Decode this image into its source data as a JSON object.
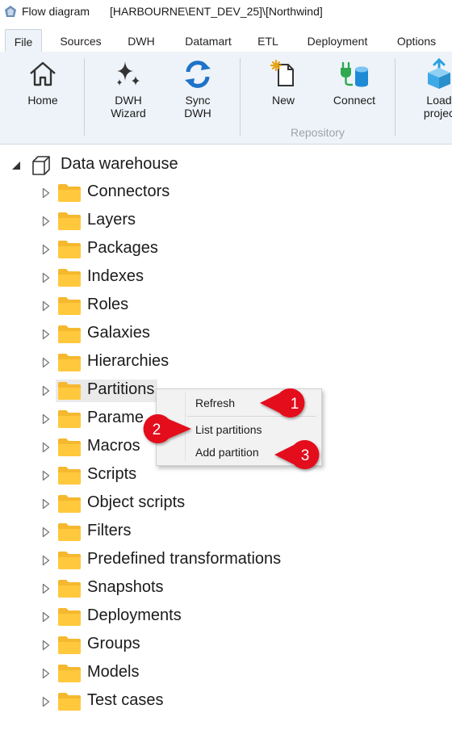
{
  "window": {
    "title": "Flow diagram",
    "path": "[HARBOURNE\\ENT_DEV_25]\\[Northwind]"
  },
  "tabs": [
    {
      "label": "File",
      "active": true
    },
    {
      "label": "Sources",
      "active": false
    },
    {
      "label": "DWH",
      "active": false
    },
    {
      "label": "Datamart",
      "active": false
    },
    {
      "label": "ETL",
      "active": false
    },
    {
      "label": "Deployment",
      "active": false
    },
    {
      "label": "Options",
      "active": false
    }
  ],
  "ribbon": {
    "home": {
      "label": "Home",
      "icon": "home-icon"
    },
    "dwh_wizard": {
      "label": "DWH\nWizard",
      "icon": "sparkle-icon"
    },
    "sync_dwh": {
      "label": "Sync\nDWH",
      "icon": "sync-icon"
    },
    "new": {
      "label": "New",
      "icon": "new-document-icon"
    },
    "connect": {
      "label": "Connect",
      "icon": "plug-database-icon"
    },
    "load_project": {
      "label": "Load\nprojec",
      "icon": "open-box-icon"
    },
    "group_repository": "Repository"
  },
  "tree": {
    "root": {
      "label": "Data warehouse",
      "icon": "cube-icon",
      "expanded": true
    },
    "items": [
      {
        "label": "Connectors"
      },
      {
        "label": "Layers"
      },
      {
        "label": "Packages"
      },
      {
        "label": "Indexes"
      },
      {
        "label": "Roles"
      },
      {
        "label": "Galaxies"
      },
      {
        "label": "Hierarchies"
      },
      {
        "label": "Partitions"
      },
      {
        "label": "Parame"
      },
      {
        "label": "Macros"
      },
      {
        "label": "Scripts"
      },
      {
        "label": "Object scripts"
      },
      {
        "label": "Filters"
      },
      {
        "label": "Predefined transformations"
      },
      {
        "label": "Snapshots"
      },
      {
        "label": "Deployments"
      },
      {
        "label": "Groups"
      },
      {
        "label": "Models"
      },
      {
        "label": "Test cases"
      }
    ],
    "selected": "Partitions"
  },
  "context_menu": {
    "items": [
      {
        "label": "Refresh"
      },
      {
        "label": "List partitions"
      },
      {
        "label": "Add partition"
      }
    ]
  },
  "callouts": [
    "1",
    "2",
    "3"
  ],
  "colors": {
    "ribbon_bg": "#eef3f9",
    "callout_red": "#e3091b",
    "folder_yellow": "#ffc83d",
    "sync_blue": "#1e73c8",
    "connect_green": "#2fa84f"
  }
}
